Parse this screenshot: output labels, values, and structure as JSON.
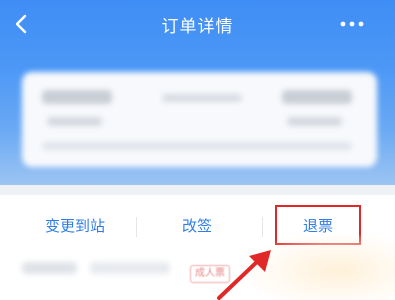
{
  "header": {
    "title": "订单详情",
    "back_icon": "chevron-left-icon",
    "more_icon": "more-horizontal-icon",
    "colors": {
      "gradient_top": "#3f8ef5",
      "gradient_bottom": "#9cc4f3"
    }
  },
  "actions": {
    "change_station": "变更到站",
    "rebook": "改签",
    "refund": "退票",
    "accent_color": "#2f7ee6",
    "highlight_color": "#e02828"
  },
  "passenger": {
    "tag": "成人票"
  }
}
